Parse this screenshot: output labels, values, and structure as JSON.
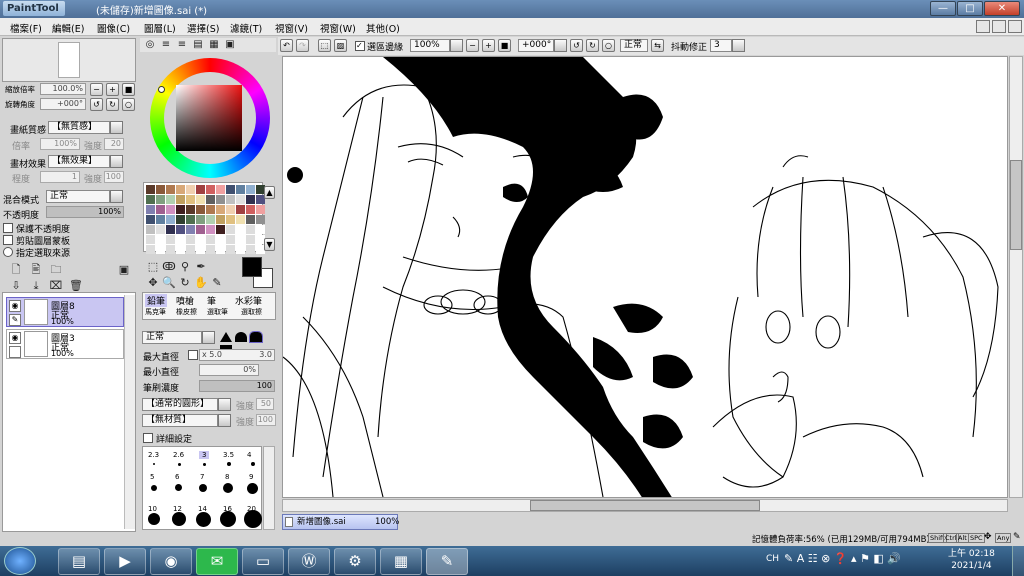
{
  "window": {
    "app_logo": "PaintTool SAI",
    "title": "(未儲存)新增圖像.sai (*)",
    "minimize": "—",
    "maximize": "□",
    "close": "✕"
  },
  "menu": {
    "items": [
      "檔案(F)",
      "編輯(E)",
      "圖像(C)",
      "圖層(L)",
      "選擇(S)",
      "濾鏡(T)",
      "視窗(V)",
      "視窗(W)",
      "其他(O)"
    ]
  },
  "navigator": {
    "zoom_label": "縮放倍率",
    "zoom_value": "100.0%",
    "rotate_label": "旋轉角度",
    "rotate_value": "+000°"
  },
  "paper": {
    "texture_label": "畫紙質感",
    "texture_value": "【無質感】",
    "scale_label": "倍率",
    "scale_value": "100%",
    "strength_label": "強度",
    "strength_value": "20",
    "effect_label": "畫材效果",
    "effect_value": "【無效果】",
    "degree_label": "程度",
    "degree_value": "1",
    "effect_strength_label": "強度",
    "effect_strength_value": "100"
  },
  "layer_props": {
    "blend_label": "混合模式",
    "blend_value": "正常",
    "opacity_label": "不透明度",
    "opacity_value": "100%",
    "check_protect": "保護不透明度",
    "check_clip": "剪貼圖層蒙板",
    "check_select": "指定選取來源"
  },
  "layers": [
    {
      "name": "圖層8",
      "mode": "正常",
      "opacity": "100%"
    },
    {
      "name": "圖層3",
      "mode": "正常",
      "opacity": "100%"
    }
  ],
  "brush": {
    "tabs": [
      "鉛筆",
      "噴槍",
      "筆",
      "水彩筆"
    ],
    "tabs_row2": [
      "馬克筆",
      "橡皮擦",
      "選取筆",
      "選取擦"
    ],
    "mode_value": "正常",
    "max_size_label": "最大直徑",
    "max_size_mult": "x 5.0",
    "max_size_value": "3.0",
    "min_size_label": "最小直徑",
    "min_size_value": "0%",
    "density_label": "筆刷濃度",
    "density_value": "100",
    "shape_value": "【通常的圓形】",
    "shape_strength_label": "強度",
    "shape_strength_value": "50",
    "texture_value": "【無材質】",
    "texture_strength_label": "強度",
    "texture_strength_value": "100",
    "detail_label": "詳細設定",
    "sizes": [
      "2.3",
      "2.6",
      "3",
      "3.5",
      "4",
      "5",
      "6",
      "7",
      "8",
      "9",
      "10",
      "12",
      "14",
      "16",
      "20"
    ]
  },
  "canvas_toolbar": {
    "selection_edge_label": "選區邊緣",
    "zoom_value": "100%",
    "angle_value": "+000°",
    "mode_value": "正常",
    "stabilizer_label": "抖動修正",
    "stabilizer_value": "3"
  },
  "document_tab": {
    "name": "新增圖像.sai",
    "zoom": "100%"
  },
  "status": {
    "memory": "記憶體負荷率:56% (已用129MB/可用794MB)",
    "keys": [
      "Shift",
      "Ctrl",
      "Alt",
      "SPC",
      "Any"
    ]
  },
  "taskbar": {
    "start_icon": "windows-start-icon",
    "lang": "CH",
    "time_period": "上午 02:18",
    "date": "2021/1/4"
  },
  "colors": {
    "primary": "#000000",
    "secondary": "#ffffff",
    "layer_selected": "#c9c6f2",
    "doc_tab": "#b7c3ef"
  }
}
